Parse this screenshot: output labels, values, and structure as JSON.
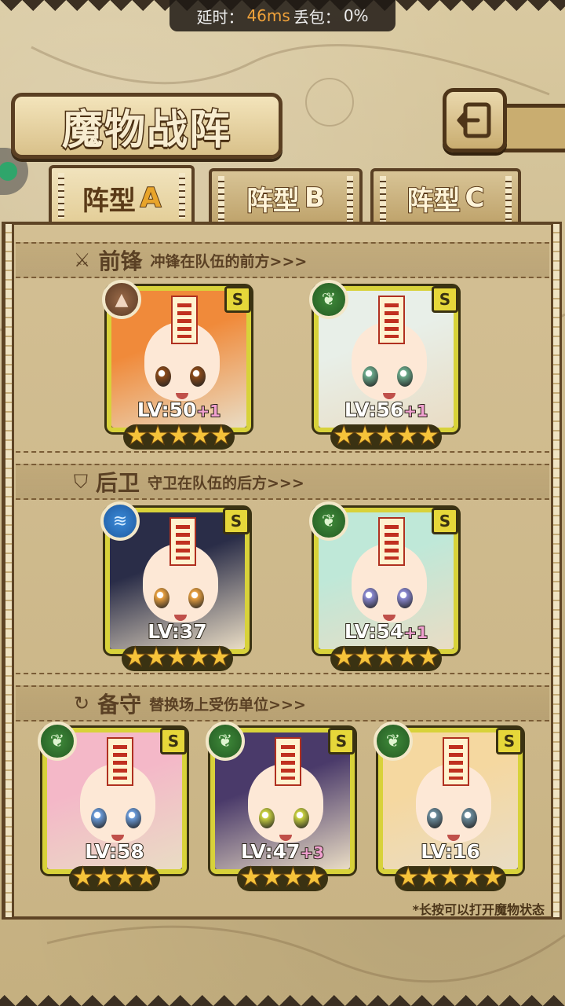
{
  "status": {
    "latency_label": "延时：",
    "latency_value": "46ms",
    "loss_label": " 丢包：",
    "loss_value": "0%"
  },
  "header": {
    "title": "魔物战阵",
    "back_icon": "back-arrow-icon"
  },
  "tabs": [
    {
      "label": "阵型",
      "letter": "A",
      "active": true
    },
    {
      "label": "阵型",
      "letter": "B",
      "active": false
    },
    {
      "label": "阵型",
      "letter": "C",
      "active": false
    }
  ],
  "sections": {
    "front": {
      "icon": "sword-icon",
      "title": "前锋",
      "desc": "冲锋在队伍的前方>>>"
    },
    "rear": {
      "icon": "shield-icon",
      "title": "后卫",
      "desc": "守卫在队伍的后方>>>"
    },
    "reserve": {
      "icon": "refresh-icon",
      "title": "备守",
      "desc": "替换场上受伤单位>>>"
    }
  },
  "cards": {
    "front": [
      {
        "element": "rock",
        "grade": "S",
        "level": "LV:50",
        "plus": "+1",
        "stars": 5,
        "hair": "#f08a3a",
        "eye": "#8a4a1a"
      },
      {
        "element": "leaf",
        "grade": "S",
        "level": "LV:56",
        "plus": "+1",
        "stars": 5,
        "hair": "#e8efe8",
        "eye": "#6aa88a"
      }
    ],
    "rear": [
      {
        "element": "water",
        "grade": "S",
        "level": "LV:37",
        "plus": "",
        "stars": 5,
        "hair": "#2a2d48",
        "eye": "#e8a040"
      },
      {
        "element": "leaf",
        "grade": "S",
        "level": "LV:54",
        "plus": "+1",
        "stars": 5,
        "hair": "#bfe8d8",
        "eye": "#8a88d0"
      }
    ],
    "reserve": [
      {
        "element": "leaf",
        "grade": "S",
        "level": "LV:58",
        "plus": "",
        "stars": 4,
        "hair": "#f4b8c8",
        "eye": "#6a9ad8"
      },
      {
        "element": "leaf",
        "grade": "S",
        "level": "LV:47",
        "plus": "+3",
        "stars": 4,
        "hair": "#4a3a6a",
        "eye": "#c8d040"
      },
      {
        "element": "leaf",
        "grade": "S",
        "level": "LV:16",
        "plus": "",
        "stars": 5,
        "hair": "#f5d8a0",
        "eye": "#6a8a9a"
      }
    ]
  },
  "tip": "*长按可以打开魔物状态",
  "colors": {
    "card_border": "#d8d23a",
    "panel_border": "#5e4425",
    "accent_orange": "#f0a23a"
  }
}
